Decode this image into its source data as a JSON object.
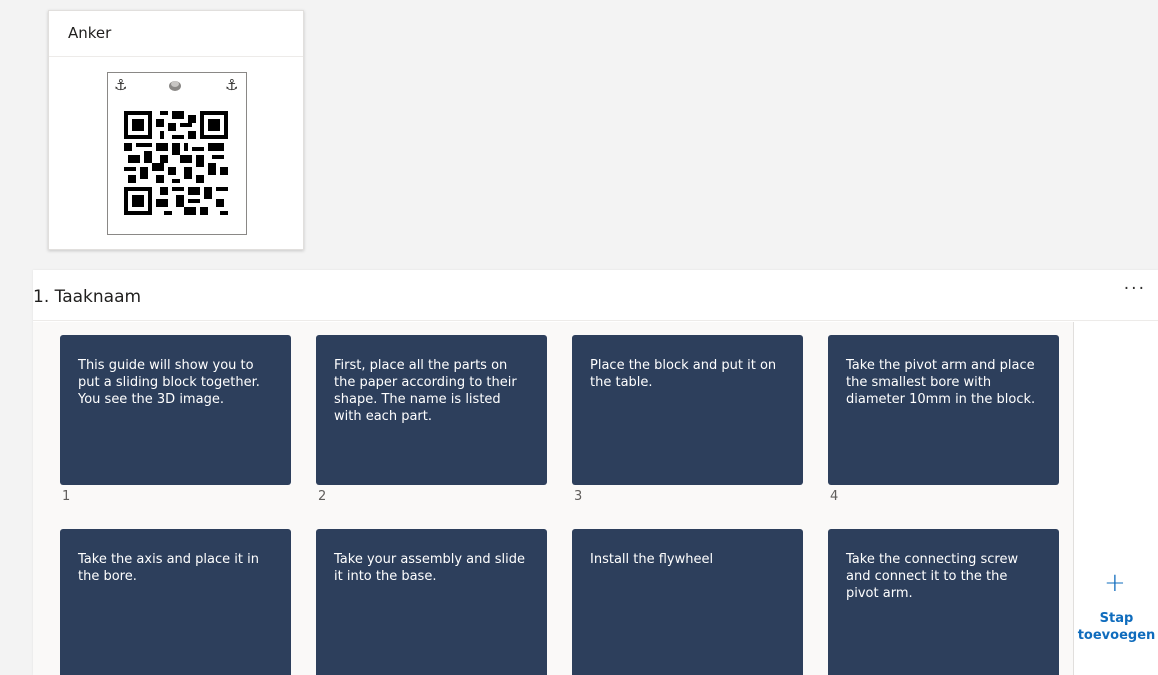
{
  "anchor": {
    "title": "Anker",
    "glyph_left": "⚓",
    "glyph_right": "⚓"
  },
  "task": {
    "title": "1. Taaknaam",
    "more": "···"
  },
  "steps": [
    {
      "text": "This guide will show you to put a sliding block together. You see the 3D image.",
      "num": "1"
    },
    {
      "text": "First, place all the parts on the paper according to their shape. The name is listed with each part.",
      "num": "2"
    },
    {
      "text": "Place the block and put it on the table.",
      "num": "3"
    },
    {
      "text": "Take the pivot arm and place the smallest bore with diameter 10mm in the block.",
      "num": "4"
    },
    {
      "text": "Take the axis and place it in the bore.",
      "num": ""
    },
    {
      "text": "Take your assembly and slide it into the base.",
      "num": ""
    },
    {
      "text": "Install the flywheel",
      "num": ""
    },
    {
      "text": "Take the connecting screw and connect it to the the pivot arm.",
      "num": ""
    }
  ],
  "add_step": {
    "plus": "+",
    "label_line1": "Stap",
    "label_line2": "toevoegen"
  },
  "colors": {
    "tile": "#2d3f5c",
    "accent": "#0f6cbd"
  }
}
